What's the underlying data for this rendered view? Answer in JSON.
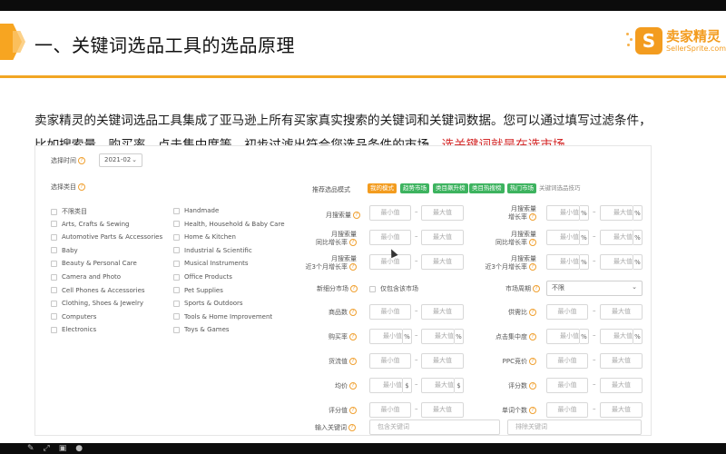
{
  "slide": {
    "title": "一、关键词选品工具的选品原理",
    "logo_cn": "卖家精灵",
    "logo_en": "SellerSprite.com",
    "para_line1": "卖家精灵的关键词选品工具集成了亚马逊上所有买家真实搜索的关键词和关键词数据。您可以通过填写过滤条件，",
    "para_line2a": "比如搜索量、购买率、点击集中度等，初步过滤出符合您选品条件的市场，",
    "para_line2b": "选关键词就是在选市场",
    "para_line2c": "。"
  },
  "colors": {
    "accent": "#f2a623",
    "highlight": "#d42a2a",
    "green": "#3db35f",
    "orange": "#f39c1f"
  },
  "form": {
    "time_label": "选择时间",
    "time_value": "2021-02",
    "category_label": "选择类目",
    "categories_col1": [
      "不限类目",
      "Arts, Crafts & Sewing",
      "Automotive Parts & Accessories",
      "Baby",
      "Beauty & Personal Care",
      "Camera and Photo",
      "Cell Phones & Accessories",
      "Clothing, Shoes & Jewelry",
      "Computers",
      "Electronics"
    ],
    "categories_col2": [
      "Handmade",
      "Health, Household & Baby Care",
      "Home & Kitchen",
      "Industrial & Scientific",
      "Musical Instruments",
      "Office Products",
      "Pet Supplies",
      "Sports & Outdoors",
      "Tools & Home Improvement",
      "Toys & Games"
    ],
    "mode_label": "推荐选品模式",
    "modes": [
      "我的模式",
      "趋势市场",
      "类目飙升榜",
      "类目热搜榜",
      "热门市场"
    ],
    "mode_link": "关键词选品技巧",
    "min_placeholder": "最小值",
    "max_placeholder": "最大值",
    "pct": "%",
    "dollar": "$",
    "monthly_search": "月搜索量",
    "monthly_growth_1": "月搜索量",
    "monthly_growth_2": "增长率",
    "yoy_1": "月搜索量",
    "yoy_2": "同比增长率",
    "yoy_g_1": "月搜索量",
    "yoy_g_2": "同比增长率",
    "q_1": "月搜索量",
    "q_2": "近3个月增长率",
    "q_g_1": "月搜索量",
    "q_g_2": "近3个月增长率",
    "new_market": "新细分市场",
    "new_market_opt": "仅包含该市场",
    "cycle_label": "市场周期",
    "cycle_value": "不限",
    "products": "商品数",
    "supply_demand": "供需比",
    "purchase_rate": "购买率",
    "click_conc": "点击集中度",
    "sales_value": "货流值",
    "ppc": "PPC竞价",
    "avg_price": "均价",
    "reviews": "评分数",
    "rating": "评分值",
    "word_count": "单词个数",
    "keyword_label": "输入关键词",
    "include_ph": "包含关键词",
    "exclude_ph": "排除关键词"
  }
}
